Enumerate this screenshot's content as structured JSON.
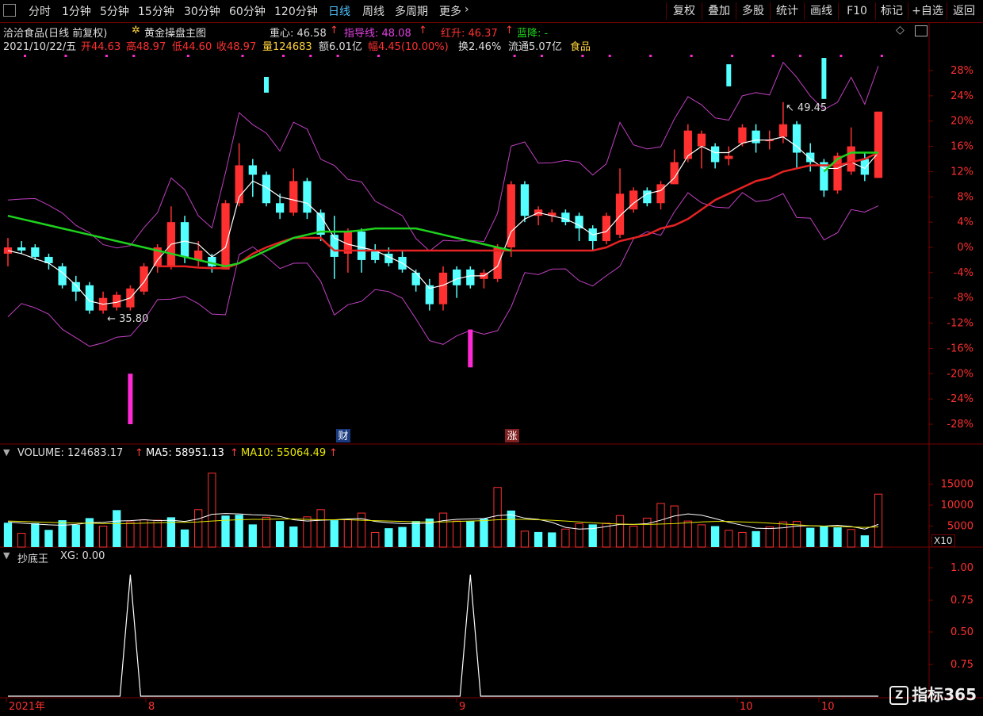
{
  "toolbar": {
    "periods": [
      "分时",
      "1分钟",
      "5分钟",
      "15分钟",
      "30分钟",
      "60分钟",
      "120分钟",
      "日线",
      "周线",
      "多周期",
      "更多"
    ],
    "active_period": "日线",
    "more_arrow": "›",
    "right_buttons": [
      "复权",
      "叠加",
      "多股",
      "统计",
      "画线",
      "F10",
      "标记",
      "+自选",
      "返回"
    ]
  },
  "header": {
    "stock": "洽洽食品(日线 前复权)",
    "indicator_icon": "sun-icon",
    "indicator": "黄金操盘主图",
    "zhongxin": "重心: 46.58",
    "zhidao": "指导线: 48.08",
    "hongsheng": "红升: 46.37",
    "lanjiang": "蓝降: -",
    "up_arrow": "↑",
    "date": "2021/10/22/五",
    "open": "开44.63",
    "high": "高48.97",
    "low": "低44.60",
    "close": "收48.97",
    "vol": "量124683",
    "amount": "额6.01亿",
    "change": "幅4.45(10.00%)",
    "turnover": "换2.46%",
    "float": "流通5.07亿",
    "sector": "食品"
  },
  "annotations": {
    "low_label": "35.80",
    "high_label": "49.45",
    "cai_badge": "财",
    "zhang_badge": "涨"
  },
  "volume_header": {
    "volume": "VOLUME: 124683.17",
    "ma5": "MA5: 58951.13",
    "ma10": "MA10: 55064.49",
    "up_arrow": "↑"
  },
  "x10_label": "X10",
  "indicator_header": {
    "name": "抄底王",
    "xg": "XG: 0.00"
  },
  "x_axis": {
    "labels": [
      "2021年",
      "8",
      "9",
      "10",
      "10"
    ]
  },
  "watermark": "指标365",
  "colors": {
    "up": "#ff3030",
    "down": "#54ffff",
    "ma_green": "#1ed21e",
    "ma_red": "#e62222",
    "envelope": "#c040c0",
    "signal": "#ff2ad4",
    "white_line": "#ffffff",
    "yellow_line": "#e6e600",
    "grid": "#7a0000"
  },
  "chart_data": [
    {
      "type": "candlestick",
      "title": "黄金操盘主图",
      "y_axis_ticks": [
        "28%",
        "24%",
        "20%",
        "16%",
        "12%",
        "8%",
        "4%",
        "0%",
        "-4%",
        "-8%",
        "-12%",
        "-16%",
        "-20%",
        "-24%",
        "-28%"
      ],
      "ylim_pct": [
        -28,
        28
      ],
      "candles_pct": [
        {
          "o": -1,
          "c": 0,
          "h": 1.5,
          "l": -3
        },
        {
          "o": 0,
          "c": -0.5,
          "h": 1,
          "l": -1
        },
        {
          "o": 0,
          "c": -1.5,
          "h": 0.5,
          "l": -2
        },
        {
          "o": -1.5,
          "c": -2.5,
          "h": -1,
          "l": -3.5
        },
        {
          "o": -3,
          "c": -6,
          "h": -2.5,
          "l": -6.5
        },
        {
          "o": -5.5,
          "c": -7,
          "h": -4.5,
          "l": -8.5
        },
        {
          "o": -6,
          "c": -10,
          "h": -5.5,
          "l": -10.5
        },
        {
          "o": -10,
          "c": -8,
          "h": -7,
          "l": -10.5
        },
        {
          "o": -9.5,
          "c": -7.5,
          "h": -7,
          "l": -10
        },
        {
          "o": -9.5,
          "c": -6.5,
          "h": -6,
          "l": -10
        },
        {
          "o": -7,
          "c": -3,
          "h": -2.5,
          "l": -7.5
        },
        {
          "o": -3,
          "c": 0,
          "h": 0.5,
          "l": -4
        },
        {
          "o": -3,
          "c": 4,
          "h": 6.5,
          "l": -3.5
        },
        {
          "o": 4,
          "c": -1.5,
          "h": 5,
          "l": -2.5
        },
        {
          "o": -2,
          "c": -0.5,
          "h": 1,
          "l": -3
        },
        {
          "o": -1.5,
          "c": -3,
          "h": -1,
          "l": -4
        },
        {
          "o": -3.5,
          "c": 7,
          "h": 7.5,
          "l": -3.5
        },
        {
          "o": 7,
          "c": 13,
          "h": 16.5,
          "l": 6.5
        },
        {
          "o": 13,
          "c": 11.5,
          "h": 14,
          "l": 8
        },
        {
          "o": 11.5,
          "c": 7,
          "h": 12,
          "l": 6.5
        },
        {
          "o": 7,
          "c": 5.5,
          "h": 8.5,
          "l": 4.5
        },
        {
          "o": 5.5,
          "c": 10.5,
          "h": 12.5,
          "l": 5
        },
        {
          "o": 10.5,
          "c": 5.5,
          "h": 11,
          "l": 4.5
        },
        {
          "o": 5.5,
          "c": 2,
          "h": 6,
          "l": 1
        },
        {
          "o": 2,
          "c": -1.5,
          "h": 5,
          "l": -5
        },
        {
          "o": -1,
          "c": 2.5,
          "h": 3,
          "l": -4
        },
        {
          "o": 2.5,
          "c": -2,
          "h": 3,
          "l": -4
        },
        {
          "o": -0.5,
          "c": -2,
          "h": 0.5,
          "l": -2.5
        },
        {
          "o": -1,
          "c": -2.5,
          "h": 0,
          "l": -3
        },
        {
          "o": -1.5,
          "c": -3.5,
          "h": -0.5,
          "l": -4
        },
        {
          "o": -4,
          "c": -6,
          "h": -3.5,
          "l": -7
        },
        {
          "o": -6,
          "c": -9,
          "h": -5,
          "l": -10
        },
        {
          "o": -9,
          "c": -4,
          "h": -3,
          "l": -10
        },
        {
          "o": -3.5,
          "c": -6,
          "h": -3,
          "l": -8
        },
        {
          "o": -3.5,
          "c": -6,
          "h": -3,
          "l": -6.5
        },
        {
          "o": -5,
          "c": -4,
          "h": -3.5,
          "l": -6.5
        },
        {
          "o": -5,
          "c": 0,
          "h": 0.5,
          "l": -5.5
        },
        {
          "o": 0,
          "c": 10,
          "h": 10.5,
          "l": -1.5
        },
        {
          "o": 10,
          "c": 5,
          "h": 10.5,
          "l": 4
        },
        {
          "o": 5,
          "c": 6,
          "h": 6.5,
          "l": 3.5
        },
        {
          "o": 5,
          "c": 5.5,
          "h": 6,
          "l": 4
        },
        {
          "o": 5.5,
          "c": 4,
          "h": 6,
          "l": 3.5
        },
        {
          "o": 5,
          "c": 3,
          "h": 5.5,
          "l": 1
        },
        {
          "o": 3,
          "c": 1,
          "h": 3.5,
          "l": -0.5
        },
        {
          "o": 1,
          "c": 5,
          "h": 5.5,
          "l": 0.5
        },
        {
          "o": 2,
          "c": 8.5,
          "h": 12.5,
          "l": 1.5
        },
        {
          "o": 6,
          "c": 9,
          "h": 9.5,
          "l": 5.5
        },
        {
          "o": 9,
          "c": 7,
          "h": 9.5,
          "l": 6.5
        },
        {
          "o": 7,
          "c": 10,
          "h": 10.5,
          "l": 6
        },
        {
          "o": 10,
          "c": 13.5,
          "h": 15.5,
          "l": 10
        },
        {
          "o": 14,
          "c": 18.5,
          "h": 19.5,
          "l": 13.5
        },
        {
          "o": 16,
          "c": 18,
          "h": 18.5,
          "l": 12.5
        },
        {
          "o": 16,
          "c": 13.5,
          "h": 16.5,
          "l": 12.5
        },
        {
          "o": 14,
          "c": 14.5,
          "h": 16,
          "l": 13
        },
        {
          "o": 16.5,
          "c": 19,
          "h": 19.5,
          "l": 16
        },
        {
          "o": 18.5,
          "c": 16.5,
          "h": 19.5,
          "l": 15
        },
        {
          "o": 17,
          "c": 17,
          "h": 18.5,
          "l": 15.5
        },
        {
          "o": 17.5,
          "c": 19.5,
          "h": 23,
          "l": 16.5
        },
        {
          "o": 19.5,
          "c": 15,
          "h": 20,
          "l": 12.5
        },
        {
          "o": 15,
          "c": 13.5,
          "h": 16.5,
          "l": 12
        },
        {
          "o": 13.5,
          "c": 9,
          "h": 14,
          "l": 8
        },
        {
          "o": 9,
          "c": 14.5,
          "h": 15,
          "l": 8.5
        },
        {
          "o": 12,
          "c": 16,
          "h": 19,
          "l": 11.5
        },
        {
          "o": 14,
          "c": 11.5,
          "h": 15,
          "l": 10.5
        },
        {
          "o": 11,
          "c": 21.5,
          "h": 21.5,
          "l": 11
        }
      ],
      "series": [
        {
          "name": "重心",
          "values": [
            -0.5,
            -1,
            -1.8,
            -2.5,
            -4,
            -6,
            -8.5,
            -9,
            -8.7,
            -8,
            -5.5,
            -2,
            0.5,
            1,
            0.5,
            -1.5,
            0,
            8,
            10.5,
            9.5,
            8,
            7.5,
            7,
            5,
            1.5,
            0.5,
            0,
            -0.5,
            -1.5,
            -2.5,
            -4,
            -6.5,
            -6,
            -5,
            -4.5,
            -4.5,
            -3,
            2.5,
            4.5,
            5.5,
            5,
            4.5,
            3.5,
            2,
            2.5,
            5,
            7,
            8.5,
            9,
            11,
            14.5,
            16,
            15,
            15,
            16.5,
            17,
            17,
            17.5,
            16,
            14,
            12.5,
            12.5,
            13.5,
            12.5,
            15
          ]
        },
        {
          "name": "指导线",
          "values": [
            null,
            null,
            null,
            null,
            null,
            null,
            null,
            null,
            null,
            null,
            null,
            -3,
            -3,
            -3,
            -3.2,
            -3.3,
            -3.3,
            -2.5,
            -1,
            0,
            0.8,
            1.5,
            1.5,
            1.5,
            -0.5,
            -0.5,
            -0.5,
            -0.5,
            -0.5,
            -0.5,
            -0.5,
            -0.5,
            -0.5,
            -0.5,
            -0.5,
            -0.5,
            -0.5,
            -0.5,
            -0.5,
            -0.5,
            -0.5,
            -0.5,
            -0.5,
            -0.5,
            0,
            1,
            1.5,
            2,
            3,
            3.5,
            4.5,
            6,
            7.5,
            8.5,
            9.5,
            10.5,
            11,
            12,
            12.5,
            13,
            13,
            13,
            13.5,
            14,
            15
          ]
        },
        {
          "name": "绿线",
          "values": [
            5,
            4.5,
            4,
            3.5,
            3,
            2.5,
            2,
            1.5,
            1,
            0.5,
            0,
            -0.5,
            -1,
            -1.5,
            -2,
            -2.5,
            -3,
            -2.5,
            -1.5,
            -0.5,
            0.5,
            1.5,
            2,
            2.5,
            2.5,
            2.5,
            2.7,
            3,
            3,
            3,
            3,
            2.5,
            2,
            1.5,
            1,
            0.5,
            0,
            -0.5,
            null,
            null,
            null,
            null,
            null,
            null,
            null,
            null,
            null,
            null,
            null,
            null,
            null,
            null,
            null,
            null,
            null,
            null,
            null,
            null,
            null,
            null,
            12,
            14,
            15,
            15,
            15
          ]
        }
      ]
    },
    {
      "type": "bar",
      "title": "VOLUME",
      "y_axis_ticks": [
        "15000",
        "10000",
        "5000"
      ],
      "ylim": [
        0,
        20000
      ],
      "values": [
        5800,
        3300,
        5700,
        4100,
        6400,
        5300,
        6900,
        5000,
        8800,
        6000,
        6500,
        6400,
        7100,
        4200,
        8900,
        17600,
        7500,
        7700,
        5400,
        7100,
        6200,
        4900,
        7200,
        8900,
        6400,
        6500,
        8100,
        3500,
        4500,
        4800,
        6200,
        6800,
        8100,
        6200,
        6200,
        6800,
        14200,
        8700,
        3800,
        3600,
        3500,
        4300,
        5600,
        5400,
        5700,
        7500,
        5000,
        6900,
        10400,
        9800,
        6200,
        5300,
        5000,
        4000,
        3500,
        3800,
        4800,
        6000,
        6100,
        4600,
        5000,
        4700,
        4200,
        2800,
        12600
      ],
      "up_flags": [
        0,
        1,
        0,
        0,
        0,
        0,
        0,
        1,
        0,
        1,
        1,
        1,
        0,
        0,
        1,
        1,
        0,
        0,
        0,
        1,
        0,
        0,
        1,
        1,
        0,
        1,
        1,
        1,
        0,
        0,
        0,
        0,
        1,
        1,
        0,
        0,
        1,
        0,
        1,
        0,
        0,
        1,
        1,
        0,
        1,
        1,
        1,
        1,
        1,
        1,
        1,
        1,
        0,
        1,
        1,
        0,
        1,
        1,
        1,
        0,
        0,
        0,
        1,
        0,
        1
      ],
      "series": [
        {
          "name": "MA5",
          "values": [
            6000,
            5700,
            5500,
            5300,
            5200,
            5400,
            5800,
            5900,
            6200,
            6300,
            6500,
            6300,
            6400,
            6100,
            6700,
            7800,
            8000,
            7900,
            7700,
            7600,
            7300,
            6500,
            6200,
            6400,
            6500,
            6700,
            6800,
            6100,
            5800,
            5600,
            5600,
            5700,
            6300,
            6600,
            6700,
            6800,
            7500,
            7700,
            6900,
            6600,
            5900,
            4700,
            4300,
            4400,
            4900,
            5400,
            5400,
            5600,
            6400,
            7400,
            7900,
            7600,
            6800,
            5900,
            5200,
            4500,
            4400,
            4600,
            5000,
            5100,
            5000,
            5200,
            4900,
            4300,
            5400
          ]
        },
        {
          "name": "MA10",
          "values": [
            6200,
            6100,
            6000,
            5900,
            5800,
            5700,
            5700,
            5600,
            5600,
            5600,
            5700,
            5800,
            5900,
            5900,
            6000,
            6200,
            6400,
            6500,
            6600,
            6600,
            6700,
            6700,
            6600,
            6500,
            6500,
            6500,
            6400,
            6300,
            6200,
            6100,
            6000,
            6000,
            6000,
            6100,
            6200,
            6300,
            6500,
            6600,
            6600,
            6500,
            6400,
            6200,
            6000,
            5800,
            5600,
            5500,
            5400,
            5400,
            5500,
            5600,
            5800,
            6000,
            6100,
            6100,
            6000,
            5900,
            5700,
            5500,
            5300,
            5100,
            5000,
            4900,
            4800,
            4700,
            4800
          ]
        }
      ]
    },
    {
      "type": "line",
      "title": "抄底王",
      "y_axis_ticks": [
        "1.00",
        "0.75",
        "0.50",
        "0.75"
      ],
      "ylim": [
        0,
        1.05
      ],
      "series": [
        {
          "name": "XG",
          "values": [
            0,
            0,
            0,
            0,
            0,
            0,
            0,
            0,
            0,
            1,
            0,
            0,
            0,
            0,
            0,
            0,
            0,
            0,
            0,
            0,
            0,
            0,
            0,
            0,
            0,
            0,
            0,
            0,
            0,
            0,
            0,
            0,
            0,
            0,
            1,
            0,
            0,
            0,
            0,
            0,
            0,
            0,
            0,
            0,
            0,
            0,
            0,
            0,
            0,
            0,
            0,
            0,
            0,
            0,
            0,
            0,
            0,
            0,
            0,
            0,
            0,
            0,
            0,
            0,
            0
          ]
        }
      ]
    }
  ]
}
